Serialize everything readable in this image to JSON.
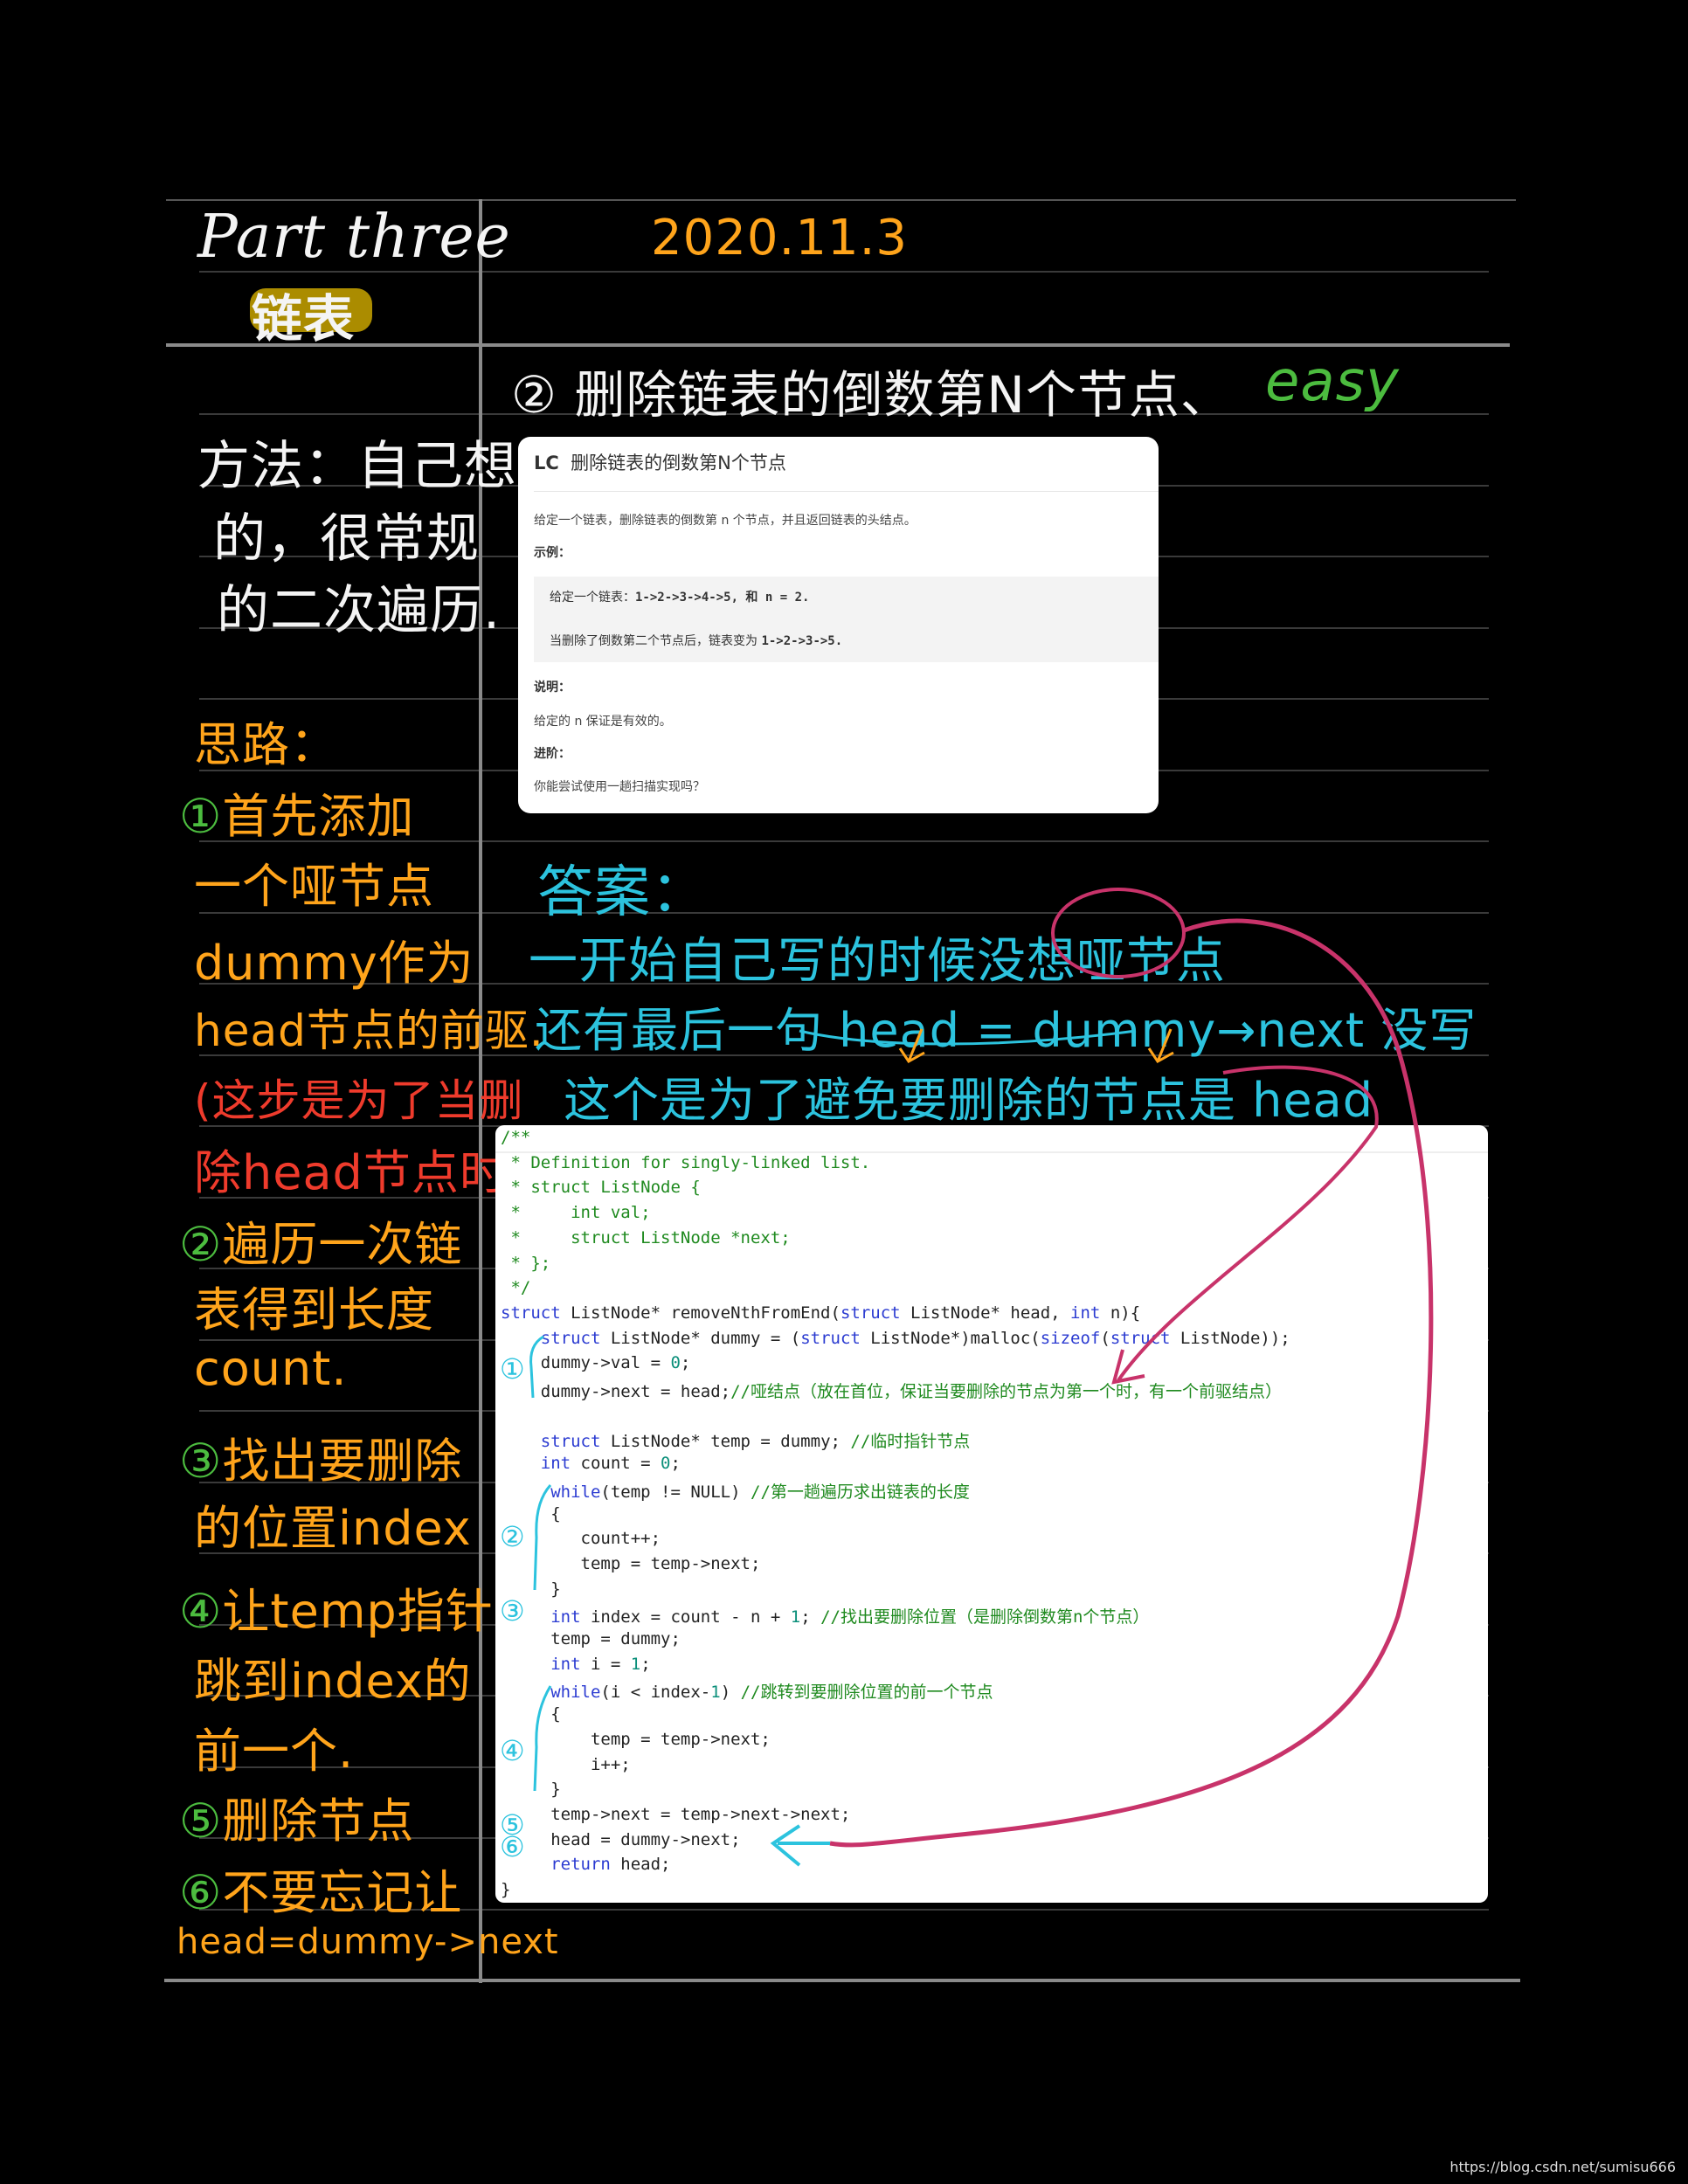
{
  "header": {
    "part_title": "Part three",
    "topic": "链表",
    "date": "2020.11.3",
    "problem_heading": "② 删除链表的倒数第N个节点、",
    "difficulty": "easy"
  },
  "method_notes": [
    "方法：自己想",
    "的，很常规",
    "的二次遍历."
  ],
  "steps": [
    {
      "text": "思路：",
      "color": "orange"
    },
    {
      "num": "①",
      "text": "首先添加",
      "color": "orange"
    },
    {
      "text": "一个哑节点",
      "color": "orange"
    },
    {
      "text": "dummy作为",
      "color": "orange"
    },
    {
      "text": "head节点的前驱.",
      "color": "orange"
    },
    {
      "text": "(这步是为了当删",
      "color": "red"
    },
    {
      "text": "除head节点时)",
      "color": "red"
    },
    {
      "num": "②",
      "text": "遍历一次链",
      "color": "orange"
    },
    {
      "text": "表得到长度",
      "color": "orange"
    },
    {
      "text": "count.",
      "color": "orange"
    },
    {
      "num": "③",
      "text": "找出要删除",
      "color": "orange"
    },
    {
      "text": "的位置index",
      "color": "orange"
    },
    {
      "num": "④",
      "text": "让temp指针",
      "color": "orange"
    },
    {
      "text": "跳到index的",
      "color": "orange"
    },
    {
      "text": "前一个.",
      "color": "orange"
    },
    {
      "num": "⑤",
      "text": "删除节点",
      "color": "orange"
    },
    {
      "num": "⑥",
      "text": "不要忘记让",
      "color": "orange"
    },
    {
      "text": "head=dummy->next",
      "color": "orange"
    }
  ],
  "problem_card": {
    "logo": "LC",
    "title": "删除链表的倒数第N个节点",
    "description": "给定一个链表，删除链表的倒数第 n 个节点，并且返回链表的头结点。",
    "example_label": "示例：",
    "example_line1_text": "给定一个链表：",
    "example_line1_code": "1->2->3->4->5, 和 n = 2.",
    "example_line2_text": "当删除了倒数第二个节点后，链表变为",
    "example_line2_code": "1->2->3->5.",
    "note_label": "说明：",
    "note_text": "给定的 n 保证是有效的。",
    "advanced_label": "进阶：",
    "advanced_text": "你能尝试使用一趟扫描实现吗？"
  },
  "answer": {
    "label": "答案：",
    "lines": [
      "一开始自己写的时候没想哑节点",
      "还有最后一句 head = dummy→next 没写",
      "这个是为了避免要删除的节点是 head"
    ]
  },
  "code_lines": [
    [
      [
        "/**",
        "cm"
      ]
    ],
    [
      [
        " * Definition for singly-linked list.",
        "cm"
      ]
    ],
    [
      [
        " * struct ListNode {",
        "cm"
      ]
    ],
    [
      [
        " *     int val;",
        "cm"
      ]
    ],
    [
      [
        " *     struct ListNode *next;",
        "cm"
      ]
    ],
    [
      [
        " * };",
        "cm"
      ]
    ],
    [
      [
        " */",
        "cm"
      ]
    ],
    [
      [
        "struct",
        "kw"
      ],
      [
        " ListNode* removeNthFromEnd(",
        ""
      ],
      [
        "struct",
        "kw"
      ],
      [
        " ListNode* head, ",
        ""
      ],
      [
        "int",
        "kw"
      ],
      [
        " n){",
        ""
      ]
    ],
    [
      [
        "    ",
        ""
      ],
      [
        "struct",
        "kw"
      ],
      [
        " ListNode* dummy = (",
        ""
      ],
      [
        "struct",
        "kw"
      ],
      [
        " ListNode*)malloc(",
        ""
      ],
      [
        "sizeof",
        "kw"
      ],
      [
        "(",
        ""
      ],
      [
        "struct",
        "kw"
      ],
      [
        " ListNode));",
        ""
      ]
    ],
    [
      [
        "    dummy->val = ",
        ""
      ],
      [
        "0",
        "num"
      ],
      [
        ";",
        ""
      ]
    ],
    [
      [
        "    dummy->next = head;",
        ""
      ],
      [
        "//哑结点（放在首位，保证当要删除的节点为第一个时，有一个前驱结点）",
        "cm"
      ]
    ],
    [
      [
        "",
        ""
      ]
    ],
    [
      [
        "    ",
        ""
      ],
      [
        "struct",
        "kw"
      ],
      [
        " ListNode* temp = dummy; ",
        ""
      ],
      [
        "//临时指针节点",
        "cm"
      ]
    ],
    [
      [
        "    ",
        ""
      ],
      [
        "int",
        "kw"
      ],
      [
        " count = ",
        ""
      ],
      [
        "0",
        "num"
      ],
      [
        ";",
        ""
      ]
    ],
    [
      [
        "     ",
        ""
      ],
      [
        "while",
        "kw"
      ],
      [
        "(temp != NULL) ",
        ""
      ],
      [
        "//第一趟遍历求出链表的长度",
        "cm"
      ]
    ],
    [
      [
        "     {",
        ""
      ]
    ],
    [
      [
        "        count++;",
        ""
      ]
    ],
    [
      [
        "        temp = temp->next;",
        ""
      ]
    ],
    [
      [
        "     }",
        ""
      ]
    ],
    [
      [
        "     ",
        ""
      ],
      [
        "int",
        "kw"
      ],
      [
        " index = count - n + ",
        ""
      ],
      [
        "1",
        "num"
      ],
      [
        "; ",
        ""
      ],
      [
        "//找出要删除位置（是删除倒数第n个节点）",
        "cm"
      ]
    ],
    [
      [
        "     temp = dummy;",
        ""
      ]
    ],
    [
      [
        "     ",
        ""
      ],
      [
        "int",
        "kw"
      ],
      [
        " i = ",
        ""
      ],
      [
        "1",
        "num"
      ],
      [
        ";",
        ""
      ]
    ],
    [
      [
        "     ",
        ""
      ],
      [
        "while",
        "kw"
      ],
      [
        "(i < index-",
        ""
      ],
      [
        "1",
        "num"
      ],
      [
        ") ",
        ""
      ],
      [
        "//跳转到要删除位置的前一个节点",
        "cm"
      ]
    ],
    [
      [
        "     {",
        ""
      ]
    ],
    [
      [
        "         temp = temp->next;",
        ""
      ]
    ],
    [
      [
        "         i++;",
        ""
      ]
    ],
    [
      [
        "     }",
        ""
      ]
    ],
    [
      [
        "     temp->next = temp->next->next;",
        ""
      ]
    ],
    [
      [
        "     head = dummy->next;",
        ""
      ]
    ],
    [
      [
        "     ",
        ""
      ],
      [
        "return",
        "kw"
      ],
      [
        " head;",
        ""
      ]
    ],
    [
      [
        "}",
        ""
      ]
    ]
  ],
  "code_annotations": [
    "①",
    "②",
    "③",
    "④",
    "⑤",
    "⑥"
  ],
  "watermark": "https://blog.csdn.net/sumisu666",
  "colors": {
    "orange": "#ffa41b",
    "green": "#4cbc3f",
    "red": "#ef3b2c",
    "cyan": "#2cc3de",
    "magenta": "#c8336a",
    "background": "#000000"
  }
}
